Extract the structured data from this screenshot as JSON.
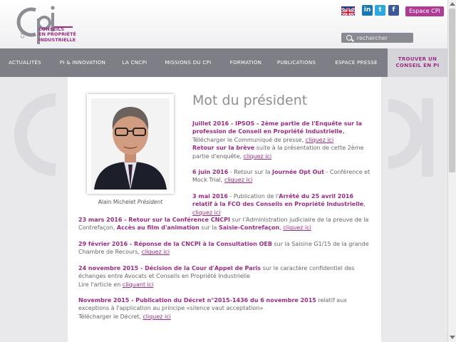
{
  "header": {
    "logo_tagline": [
      "CONSEILS",
      "EN PROPRIÉTÉ",
      "INDUSTRIELLE"
    ],
    "social": {
      "linkedin": "in",
      "twitter": "t",
      "facebook": "f"
    },
    "espace_cpi": "Espace CPI",
    "search_placeholder": "rechercher"
  },
  "nav": {
    "items": [
      "ACTUALITÉS",
      "PI & INNOVATION",
      "LA CNCPI",
      "MISSIONS DU CPI",
      "FORMATION",
      "PUBLICATIONS",
      "ESPACE PRESSE"
    ],
    "cta_line1": "TROUVER UN",
    "cta_line2": "CONSEIL EN PI"
  },
  "main": {
    "title": "Mot du président",
    "photo_name": "Alain Michelet",
    "photo_role": "Président",
    "news": [
      {
        "date": "Juillet 2016 - IPSOS",
        "text1": " - 2ème partie de l'Enquête sur la profession de Conseil en Propriété Industrielle.",
        "line2": "Télécharger le Communiqué de presse, ",
        "link1": "cliquez ici",
        "bold2": "Retour sur la brève",
        "line3": " suite à la présentation de cette 2ème partie d'enquête, ",
        "link2": "cliquez ici"
      },
      {
        "date": "6 juin 2016",
        "pre": " - Retour sur la ",
        "bold": "Journée Opt Out",
        "post": " - Conférence et Mock Trial, ",
        "link": "cliquez ici"
      },
      {
        "date": "3 mai 2016",
        "pre": " - Publication de l'",
        "bold": "Arrêté du 25 avril 2016 relatif à la FCO des Conseils en Propriété Industrielle",
        "post": ", ",
        "link": "cliquez ici"
      },
      {
        "date": "23 mars 2016 - Retour sur la Conférence CNCPI",
        "pre": " sur l'Administration judiciaire de la preuve de la Contrefaçon, ",
        "bold": "Accès au film d'animation",
        "mid": " sur la ",
        "bold2": "Saisie-Contrefaçon",
        "post": ", ",
        "link": "cliquez ici"
      },
      {
        "date": "29 février 2016 - Réponse de la CNCPI à la Consultation OEB",
        "pre": " sur la Saisine G1/15 de la grande Chambre de Recours, ",
        "link": "cliquez ici"
      },
      {
        "date": "24 novembre 2015 - Décision de la Cour d'Appel de Paris",
        "pre": " sur le caractère confidentiel des échanges entre Avocats et Conseils en Propriété Industrielle",
        "line2": "Lire l'article en ",
        "link": "cliquant ici"
      },
      {
        "date": "Novembre 2015 - Publication du Décret n°2015-1436 du 6 novembre 2015",
        "pre": " relatif aux exceptions à l'application au principe «silence vaut acceptation»",
        "line2": "Télécharger le Décret, ",
        "link": "cliquez ici"
      }
    ]
  },
  "colors": {
    "brand": "#9b2c84",
    "nav_bg": "#7e7f86",
    "page_bg": "#e9e9ec"
  }
}
